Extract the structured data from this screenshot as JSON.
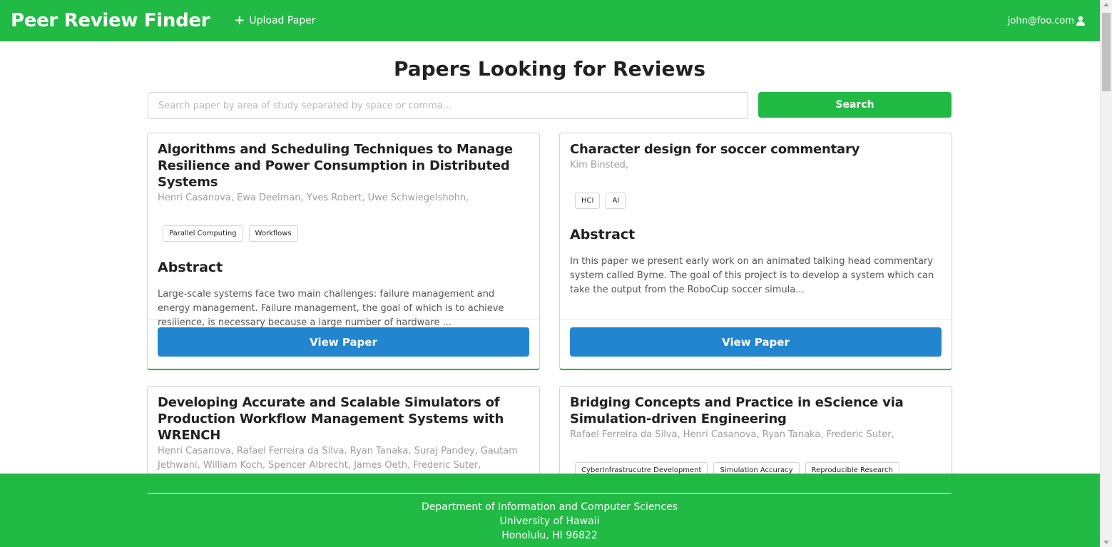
{
  "header": {
    "brand": "Peer Review Finder",
    "upload_label": "Upload Paper",
    "user_email": "john@foo.com"
  },
  "main": {
    "title": "Papers Looking for Reviews",
    "search_placeholder": "Search paper by area of study separated by space or comma...",
    "search_button": "Search",
    "abstract_heading": "Abstract",
    "view_button": "View Paper",
    "papers": [
      {
        "title": "Algorithms and Scheduling Techniques to Manage Resilience and Power Consumption in Distributed Systems",
        "authors": "Henri Casanova, Ewa Deelman, Yves Robert, Uwe Schwiegelshohn,",
        "tags": [
          "Parallel Computing",
          "Workflows"
        ],
        "abstract": "Large-scale systems face two main challenges: failure management and energy management. Failure management, the goal of which is to achieve resilience, is necessary because a large number of hardware ..."
      },
      {
        "title": "Character design for soccer commentary",
        "authors": "Kim Binsted,",
        "tags": [
          "HCI",
          "AI"
        ],
        "abstract": "In this paper we present early work on an animated talking head commentary system called Byrne. The goal of this project is to develop a system which can take the output from the RoboCup soccer simula..."
      },
      {
        "title": "Developing Accurate and Scalable Simulators of Production Workflow Management Systems with WRENCH",
        "authors": "Henri Casanova, Rafael Ferreira da Silva, Ryan Tanaka, Suraj Pandey, Gautam Jethwani, William Koch, Spencer Albrecht, James Oeth, Frederic Suter,",
        "tags": [],
        "abstract": ""
      },
      {
        "title": "Bridging Concepts and Practice in eScience via Simulation-driven Engineering",
        "authors": "Rafael Ferreira da Silva, Henri Casanova, Ryan Tanaka, Frederic Suter,",
        "tags": [
          "CyberInfrastrucutre Development",
          "Simulation Accuracy",
          "Reproducible Research"
        ],
        "abstract": ""
      }
    ]
  },
  "footer": {
    "line1": "Department of Information and Computer Sciences",
    "line2": "University of Hawaii",
    "line3": "Honolulu, HI 96822"
  },
  "colors": {
    "brand_green": "#21ba45",
    "button_blue": "#2185d0"
  },
  "icons": {
    "upload": "plus-icon",
    "user": "user-icon"
  }
}
